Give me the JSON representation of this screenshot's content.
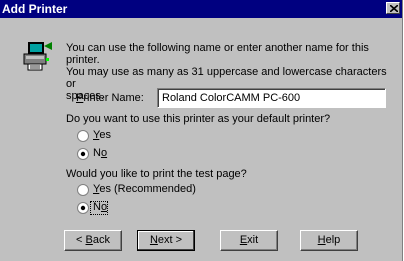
{
  "window": {
    "title": "Add Printer"
  },
  "intro": {
    "line1": "You can use the following name or enter another name for this printer.",
    "line2": "You may use as many as 31 uppercase and lowercase characters or",
    "line3": "spaces."
  },
  "printer_name": {
    "label_u": "P",
    "label_rest": "rinter Name:",
    "value": "Roland ColorCAMM PC-600"
  },
  "default_printer": {
    "question": "Do you want to use this printer as your default printer?",
    "yes_u": "Y",
    "yes_rest": "es",
    "no_rest": "N",
    "no_u": "o",
    "selected": "No"
  },
  "test_page": {
    "question": "Would you like to print the test page?",
    "yes_u": "Y",
    "yes_rest": "es (Recommended)",
    "no_rest": "N",
    "no_u": "o",
    "selected": "No"
  },
  "buttons": {
    "back_pre": "< ",
    "back_u": "B",
    "back_rest": "ack",
    "next_u": "N",
    "next_rest": "ext >",
    "exit_u": "E",
    "exit_rest": "xit",
    "help_u": "H",
    "help_rest": "elp"
  },
  "icons": {
    "printer": "printer-icon",
    "close": "close-icon"
  }
}
